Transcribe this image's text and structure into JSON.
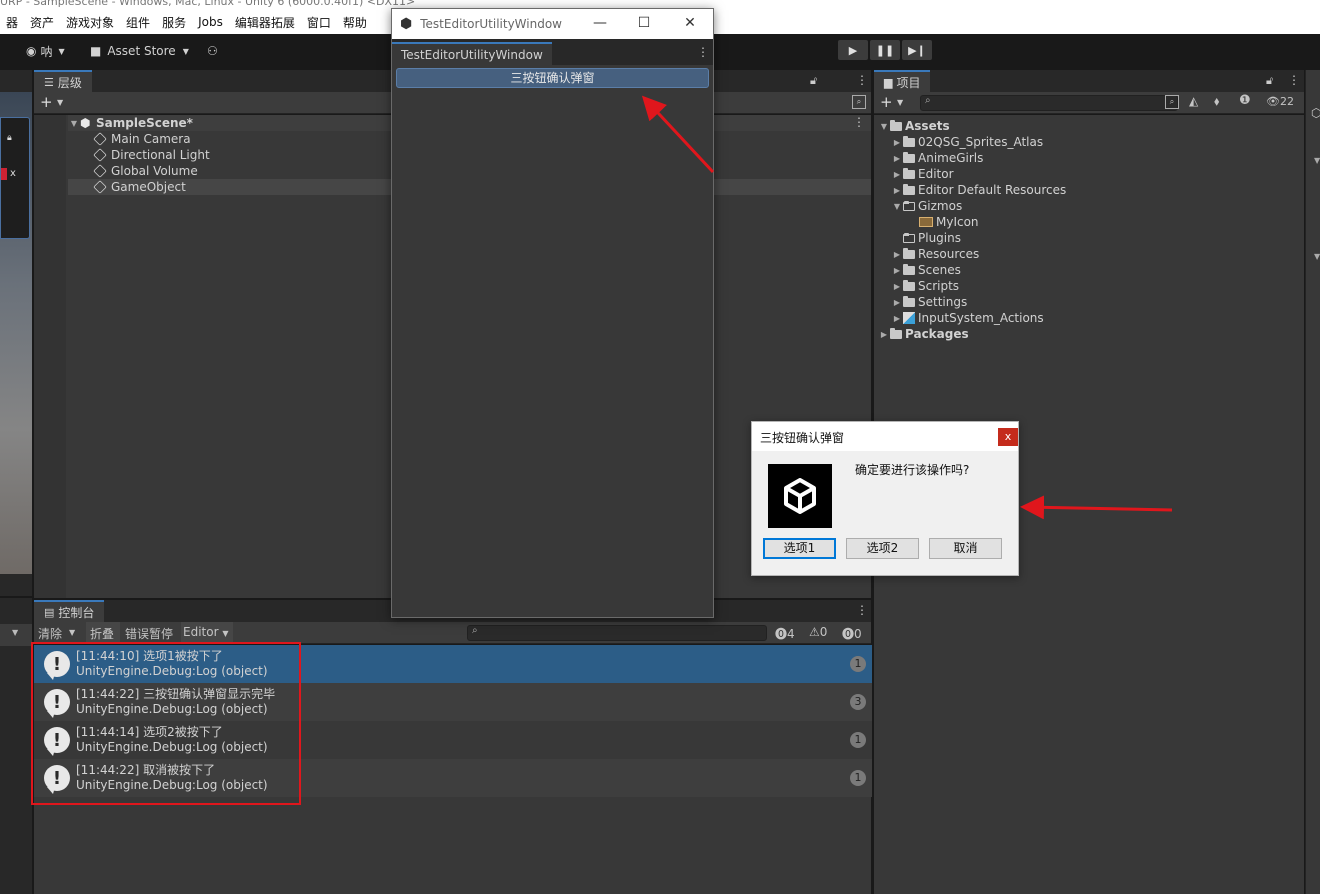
{
  "titlebar": {
    "text": "URP - SampleScene - Windows, Mac, Linux - Unity 6 (6000.0.40f1) <DX11>"
  },
  "menu": [
    "器",
    "资产",
    "游戏对象",
    "组件",
    "服务",
    "Jobs",
    "编辑器拓展",
    "窗口",
    "帮助"
  ],
  "toolbar": {
    "account": "呐",
    "asset_store": "Asset Store",
    "play": "▶",
    "pause": "❚❚",
    "step": "▶❙"
  },
  "hierarchy": {
    "tab": "层级",
    "scene": "SampleScene*",
    "items": [
      "Main Camera",
      "Directional Light",
      "Global Volume",
      "GameObject"
    ]
  },
  "utility_window": {
    "title": "TestEditorUtilityWindow",
    "tab": "TestEditorUtilityWindow",
    "button": "三按钮确认弹窗"
  },
  "project": {
    "tab": "项目",
    "hidden_count": "22",
    "root": "Assets",
    "folders": [
      {
        "name": "02QSG_Sprites_Atlas",
        "arrow": "▶"
      },
      {
        "name": "AnimeGirls",
        "arrow": "▶"
      },
      {
        "name": "Editor",
        "arrow": "▶"
      },
      {
        "name": "Editor Default Resources",
        "arrow": "▶"
      },
      {
        "name": "Gizmos",
        "arrow": "▼"
      },
      {
        "name": "MyIcon",
        "arrow": ""
      },
      {
        "name": "Plugins",
        "arrow": ""
      },
      {
        "name": "Resources",
        "arrow": "▶"
      },
      {
        "name": "Scenes",
        "arrow": "▶"
      },
      {
        "name": "Scripts",
        "arrow": "▶"
      },
      {
        "name": "Settings",
        "arrow": "▶"
      },
      {
        "name": "InputSystem_Actions",
        "arrow": "▶"
      }
    ],
    "packages": "Packages"
  },
  "console": {
    "tab": "控制台",
    "clear": "清除",
    "collapse": "折叠",
    "error_pause": "错误暂停",
    "editor": "Editor",
    "counts": {
      "log": "4",
      "warn": "0",
      "error": "0"
    },
    "entries": [
      {
        "line1": "[11:44:10] 选项1被按下了",
        "line2": "UnityEngine.Debug:Log (object)",
        "count": "1"
      },
      {
        "line1": "[11:44:22] 三按钮确认弹窗显示完毕",
        "line2": "UnityEngine.Debug:Log (object)",
        "count": "3"
      },
      {
        "line1": "[11:44:14] 选项2被按下了",
        "line2": "UnityEngine.Debug:Log (object)",
        "count": "1"
      },
      {
        "line1": "[11:44:22] 取消被按下了",
        "line2": "UnityEngine.Debug:Log (object)",
        "count": "1"
      }
    ]
  },
  "dialog": {
    "title": "三按钮确认弹窗",
    "close": "x",
    "message": "确定要进行该操作吗?",
    "buttons": [
      "选项1",
      "选项2",
      "取消"
    ]
  },
  "colors": {
    "accent": "#3a79bb",
    "selected_row": "#2c5d87",
    "annotation_red": "#e0161c"
  }
}
